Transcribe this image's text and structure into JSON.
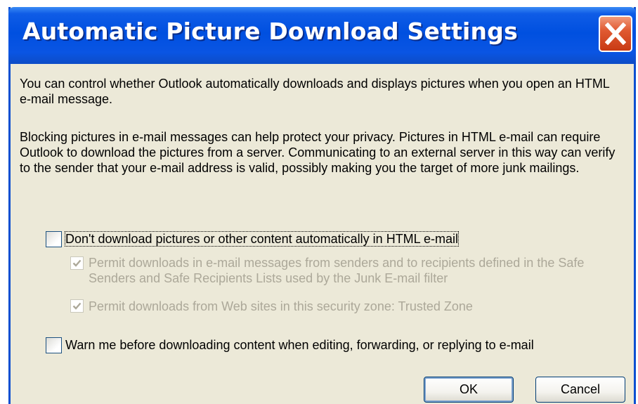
{
  "dialog": {
    "title": "Automatic Picture Download Settings"
  },
  "intro": {
    "paragraph1": "You can control whether Outlook automatically downloads and displays pictures when you open an HTML e-mail message.",
    "paragraph2": "Blocking pictures in e-mail messages can help protect your privacy. Pictures in HTML e-mail can require Outlook to download the pictures from a server. Communicating to an external server in this way can verify to the sender that your e-mail address is valid, possibly making you the target of more junk mailings."
  },
  "options": {
    "dont_download": {
      "label": "Don't download pictures or other content automatically in HTML e-mail",
      "checked": false
    },
    "permit_safe_senders": {
      "label": "Permit downloads in e-mail messages from senders and to recipients defined in the Safe Senders and Safe Recipients Lists used by the Junk E-mail filter",
      "checked": true,
      "enabled": false
    },
    "permit_trusted_zone": {
      "label": "Permit downloads from Web sites in this security zone: Trusted Zone",
      "checked": true,
      "enabled": false
    },
    "warn_before_download": {
      "label": "Warn me before downloading content when editing, forwarding, or replying to e-mail",
      "checked": false
    }
  },
  "buttons": {
    "ok_label": "OK",
    "cancel_label": "Cancel"
  },
  "icons": {
    "close": "close-icon",
    "checkmark": "checkmark-icon"
  },
  "colors": {
    "titlebar": "#0050e0",
    "close_button": "#e05a32",
    "dialog_background": "#ece9d8",
    "disabled_text": "#aca899"
  }
}
